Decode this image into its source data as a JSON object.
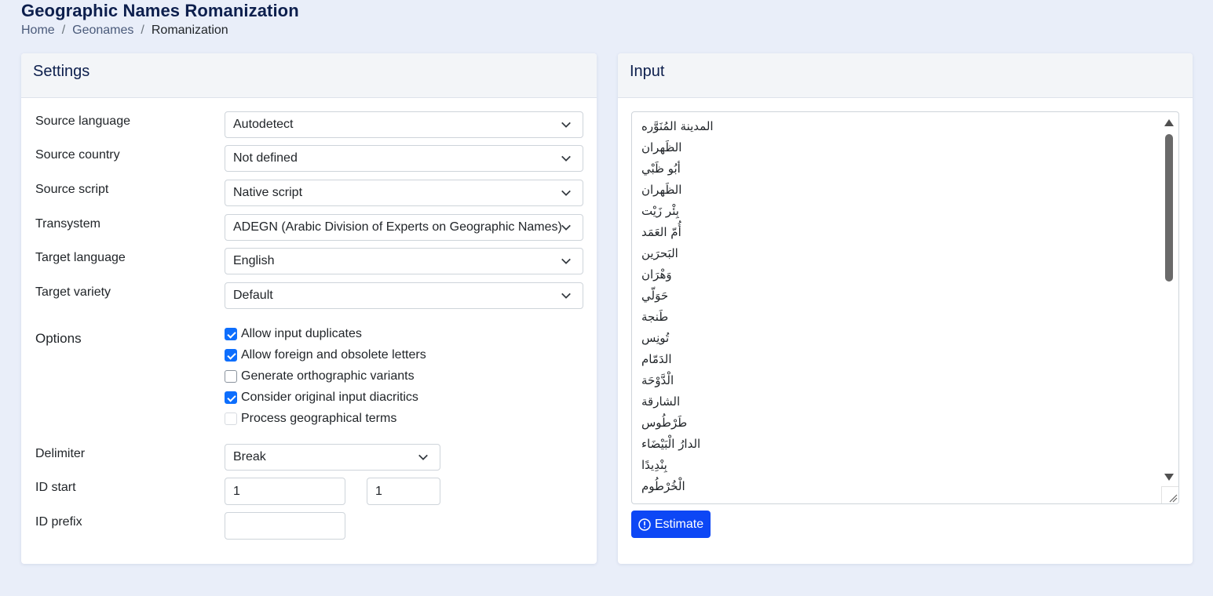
{
  "page": {
    "title": "Geographic Names Romanization",
    "breadcrumb": [
      "Home",
      "Geonames",
      "Romanization"
    ]
  },
  "settings": {
    "header": "Settings",
    "fields": [
      {
        "label": "Source language",
        "value": "Autodetect"
      },
      {
        "label": "Source country",
        "value": "Not defined"
      },
      {
        "label": "Source script",
        "value": "Native script"
      },
      {
        "label": "Transystem",
        "value": "ADEGN (Arabic Division of Experts on Geographic Names)"
      },
      {
        "label": "Target language",
        "value": "English"
      },
      {
        "label": "Target variety",
        "value": "Default"
      }
    ],
    "options_label": "Options",
    "options": [
      {
        "label": "Allow input duplicates",
        "checked": true,
        "disabled": false
      },
      {
        "label": "Allow foreign and obsolete letters",
        "checked": true,
        "disabled": false
      },
      {
        "label": "Generate orthographic variants",
        "checked": false,
        "disabled": false
      },
      {
        "label": "Consider original input diacritics",
        "checked": true,
        "disabled": false
      },
      {
        "label": "Process geographical terms",
        "checked": false,
        "disabled": true
      }
    ],
    "delimiter": {
      "label": "Delimiter",
      "value": "Break"
    },
    "id_start": {
      "label": "ID start",
      "value1": "1",
      "value2": "1"
    },
    "id_prefix": {
      "label": "ID prefix",
      "value": ""
    }
  },
  "input": {
    "header": "Input",
    "lines": [
      "المدينة المُنَوَّره",
      "الظَهران",
      "أبُو ظَبْي",
      "الظَهران",
      "بِئْر زَيْت",
      "أُمّ العَمَد",
      "البَحرَين",
      "وَهْرَان",
      "حَوَلّي",
      "طَنجة",
      "تُونِس",
      "الدَمّام",
      "الْدَّوْحَة",
      "الشارقة",
      "طَرْطُوس",
      "الدارُ الْبَيْضَاء",
      "بِنْدِيدًا",
      "الْخُرْطُوم"
    ],
    "estimate_label": "Estimate"
  },
  "icons": {
    "select": "chevron-down-icon",
    "estimate": "exclamation-circle-icon"
  },
  "colors": {
    "accent": "#0d47f5",
    "title": "#0d1f4d",
    "checkbox": "#0d6efd"
  }
}
